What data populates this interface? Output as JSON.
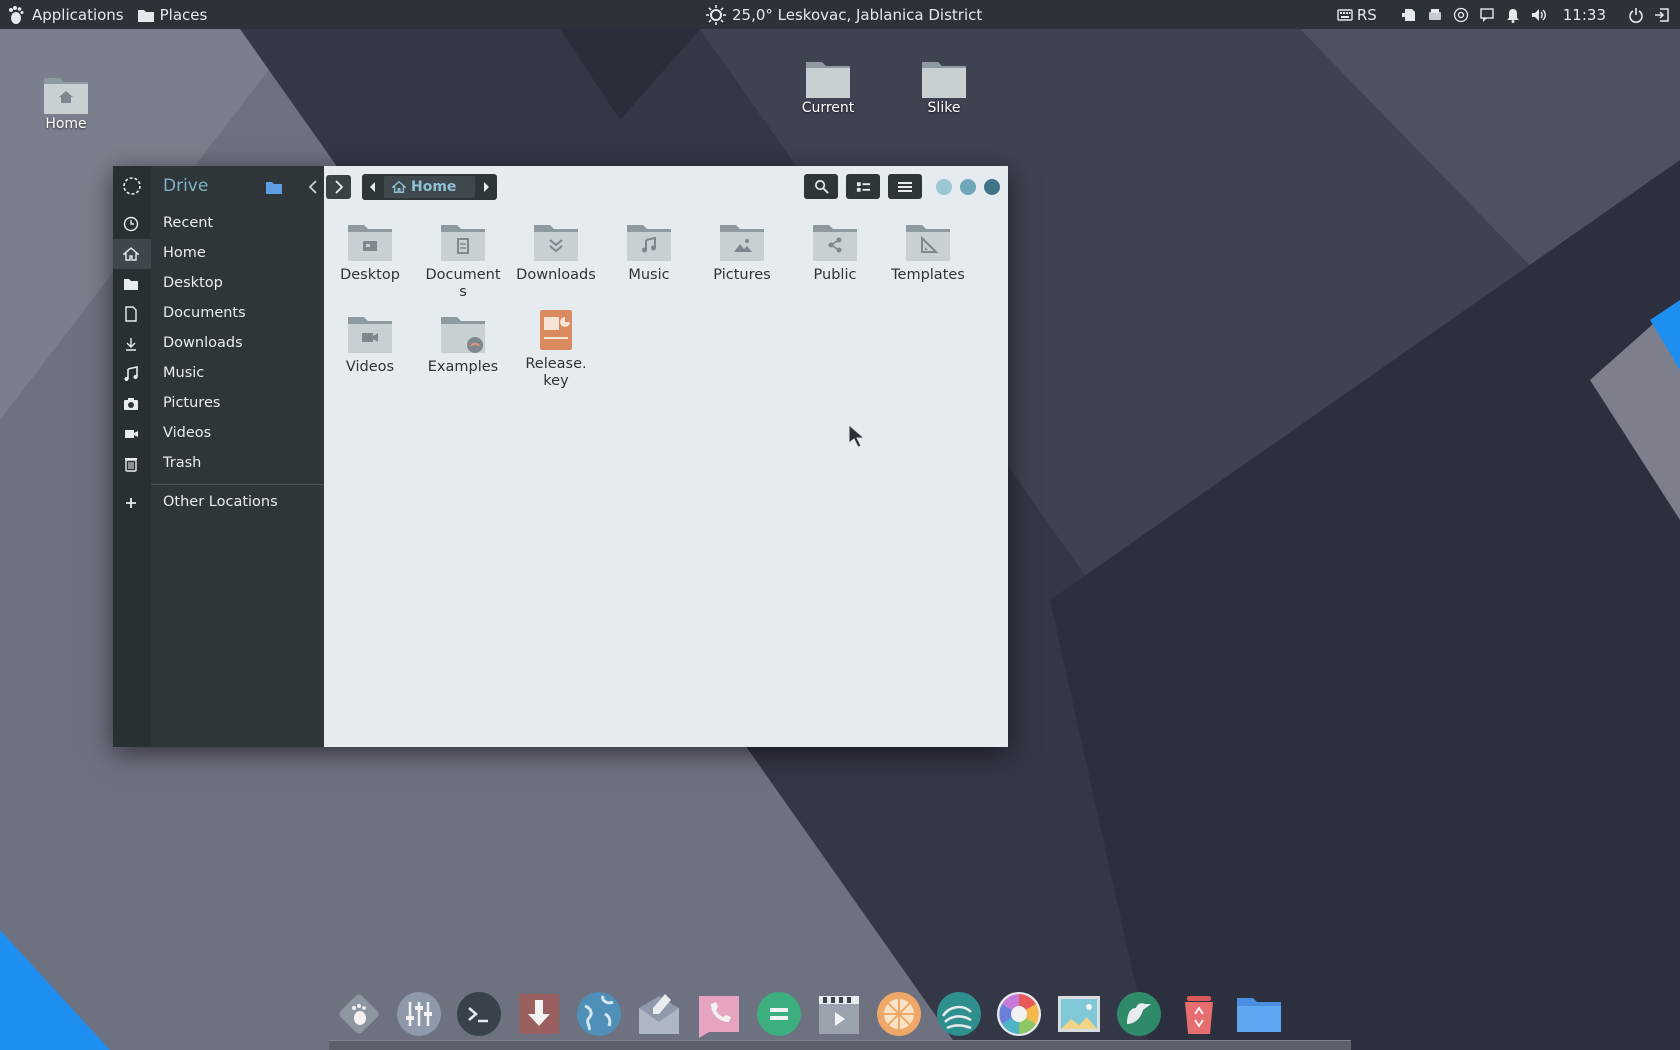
{
  "top_panel": {
    "applications_label": "Applications",
    "places_label": "Places",
    "weather": "25,0°  Leskovac, Jablanica District",
    "keyboard_layout": "RS",
    "clock": "11:33"
  },
  "desktop": {
    "icons": [
      {
        "label": "Home"
      },
      {
        "label": "Current"
      },
      {
        "label": "Slike"
      }
    ]
  },
  "file_manager": {
    "sidebar": {
      "header": "Drive",
      "items": [
        {
          "label": "Recent",
          "icon": "clock-icon"
        },
        {
          "label": "Home",
          "icon": "home-icon",
          "active": true
        },
        {
          "label": "Desktop",
          "icon": "folder-icon"
        },
        {
          "label": "Documents",
          "icon": "document-icon"
        },
        {
          "label": "Downloads",
          "icon": "download-icon"
        },
        {
          "label": "Music",
          "icon": "music-note-icon"
        },
        {
          "label": "Pictures",
          "icon": "camera-icon"
        },
        {
          "label": "Videos",
          "icon": "video-icon"
        },
        {
          "label": "Trash",
          "icon": "trash-icon"
        }
      ],
      "other_locations": "Other Locations"
    },
    "path": {
      "current": "Home"
    },
    "files": [
      {
        "label": "Desktop",
        "icon": "folder-desktop-icon"
      },
      {
        "label": "Documents",
        "icon": "folder-documents-icon"
      },
      {
        "label": "Downloads",
        "icon": "folder-downloads-icon"
      },
      {
        "label": "Music",
        "icon": "folder-music-icon"
      },
      {
        "label": "Pictures",
        "icon": "folder-pictures-icon"
      },
      {
        "label": "Public",
        "icon": "folder-public-icon"
      },
      {
        "label": "Templates",
        "icon": "folder-templates-icon"
      },
      {
        "label": "Videos",
        "icon": "folder-videos-icon"
      },
      {
        "label": "Examples",
        "icon": "folder-examples-icon"
      },
      {
        "label": "Release.\nkey",
        "icon": "presentation-file-icon"
      }
    ]
  },
  "dock": {
    "apps": [
      "gnome-foot-icon",
      "mixer-icon",
      "terminal-icon",
      "download-manager-icon",
      "globe-icon",
      "mail-icon",
      "phone-icon",
      "calculator-icon",
      "video-editor-icon",
      "citrus-icon",
      "wave-icon",
      "color-wheel-icon",
      "image-viewer-icon",
      "bird-icon",
      "recycle-bin-icon",
      "files-folder-icon"
    ]
  },
  "colors": {
    "panel": "#2d3138",
    "sidebar": "#2f3639",
    "content": "#e6ebef",
    "accent": "#7fb3c4"
  }
}
